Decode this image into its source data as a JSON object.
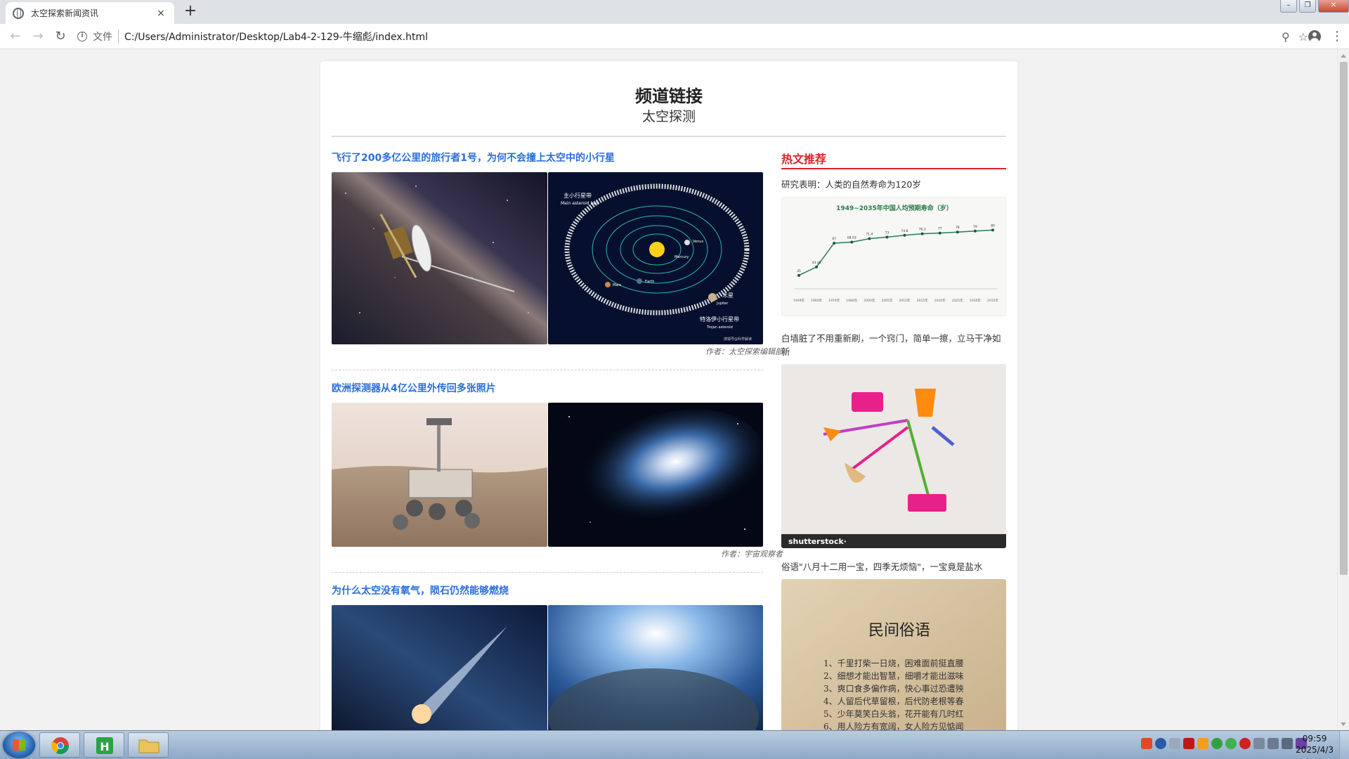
{
  "browser": {
    "tab_title": "太空探索新闻资讯",
    "tab_close": "×",
    "new_tab": "+",
    "file_label": "文件",
    "url": "C:/Users/Administrator/Desktop/Lab4-2-129-牛缩彪/index.html",
    "icons": [
      "back-icon",
      "forward-icon",
      "reload-icon",
      "info-icon",
      "zoom-icon",
      "star-icon",
      "account-icon",
      "menu-icon"
    ]
  },
  "page": {
    "heading": "频道链接",
    "subheading": "太空探测",
    "articles": [
      {
        "title": "飞行了200多亿公里的旅行者1号，为何不会撞上太空中的小行星",
        "author": "作者：太空探索编辑部"
      },
      {
        "title": "欧洲探测器从4亿公里外传回多张照片",
        "author": "作者：宇宙观察者"
      },
      {
        "title": "为什么太空没有氧气，陨石仍然能够燃烧",
        "author": ""
      }
    ],
    "sidebar": {
      "heading": "热文推荐",
      "items": [
        {
          "title": "研究表明：人类的自然寿命为120岁"
        },
        {
          "title": "白墙脏了不用重新刷，一个窍门，简单一擦，立马干净如新"
        },
        {
          "title": "俗语\"八月十二用一宝，四季无烦恼\"，一宝竟是盐水"
        }
      ]
    },
    "images": {
      "asteroid_labels": [
        "主小行星带",
        "Main asteroid belt",
        "Venus",
        "Mercury",
        "Mars",
        "Earth",
        "木星",
        "Jupiter",
        "特洛伊小行星带",
        "Trojan asteroid",
        "搜狐号@科学解读"
      ],
      "life_chart": {
        "title": "1949~2035年中国人均预期寿命（岁）",
        "categories": [
          "1949年",
          "1960年",
          "1970年",
          "1980年",
          "2000年",
          "2005年",
          "2010年",
          "2015年",
          "2020年",
          "2025年",
          "2030年",
          "2035年"
        ],
        "values": [
          35,
          43.35,
          67,
          68.03,
          71.4,
          73,
          74.8,
          76.3,
          77,
          78,
          79,
          80
        ],
        "value_labels": [
          "35",
          "43.35",
          "67",
          "68.03",
          "71.4",
          "73",
          "74.8",
          "76.3",
          "77",
          "78",
          "79",
          "80"
        ]
      },
      "shutterstock_label": "shutterstock·",
      "folk_book": {
        "title": "民间俗语",
        "lines": [
          "1、千里打柴一日烧，困难面前挺直腰",
          "2、细想才能出智慧，细嚼才能出滋味",
          "3、爽口食多偏作病，快心事过恐遭殃",
          "4、人留后代草留根，后代防老根等春",
          "5、少年莫笑白头翁，花开能有几时红",
          "6、用人险方有宽阔，女人险方见惦闻"
        ]
      }
    }
  },
  "taskbar": {
    "time": "09:59",
    "date": "2025/4/3",
    "apps": [
      "chrome-icon",
      "hbuilder-icon",
      "folder-icon"
    ]
  }
}
